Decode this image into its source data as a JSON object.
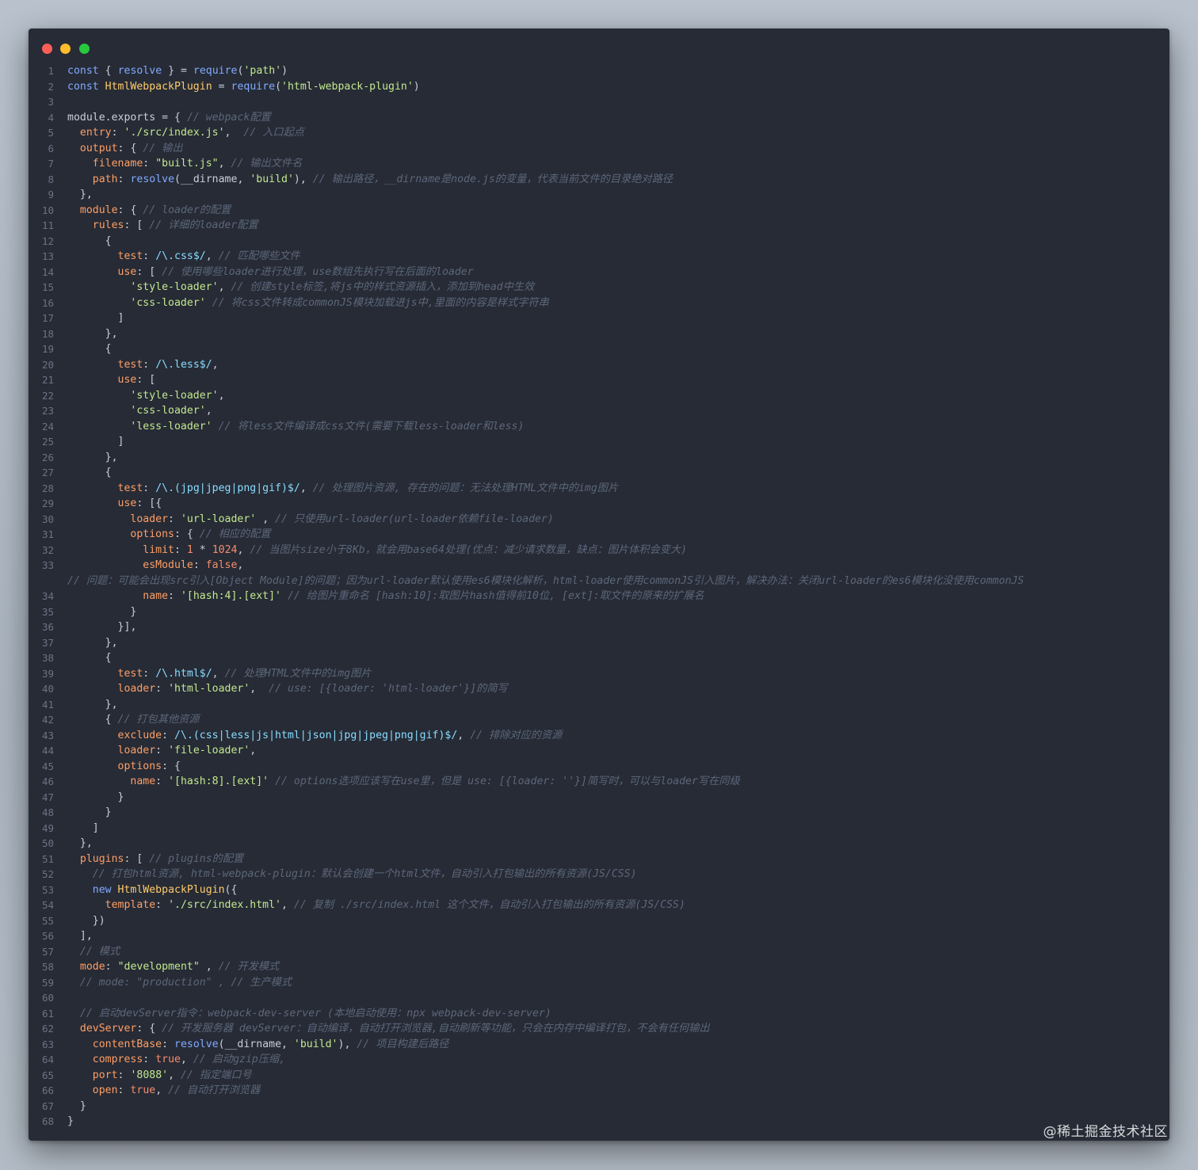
{
  "window": {
    "buttons": [
      {
        "name": "close",
        "color": "#fd5f57"
      },
      {
        "name": "minimize",
        "color": "#febc2e"
      },
      {
        "name": "maximize",
        "color": "#28c840"
      }
    ]
  },
  "code_lines": [
    {
      "n": "1",
      "t": "const { resolve } = require('path')"
    },
    {
      "n": "2",
      "t": "const HtmlWebpackPlugin = require('html-webpack-plugin')"
    },
    {
      "n": "3",
      "t": ""
    },
    {
      "n": "4",
      "t": "module.exports = { // webpack配置"
    },
    {
      "n": "5",
      "t": "  entry: './src/index.js',  // 入口起点"
    },
    {
      "n": "6",
      "t": "  output: { // 输出"
    },
    {
      "n": "7",
      "t": "    filename: \"built.js\", // 输出文件名"
    },
    {
      "n": "8",
      "t": "    path: resolve(__dirname, 'build'), // 输出路径，__dirname是node.js的变量，代表当前文件的目录绝对路径"
    },
    {
      "n": "9",
      "t": "  },"
    },
    {
      "n": "10",
      "t": "  module: { // loader的配置"
    },
    {
      "n": "11",
      "t": "    rules: [ // 详细的loader配置"
    },
    {
      "n": "12",
      "t": "      {"
    },
    {
      "n": "13",
      "t": "        test: /\\.css$/, // 匹配哪些文件"
    },
    {
      "n": "14",
      "t": "        use: [ // 使用哪些loader进行处理，use数组先执行写在后面的loader"
    },
    {
      "n": "15",
      "t": "          'style-loader', // 创建style标签,将js中的样式资源插入，添加到head中生效"
    },
    {
      "n": "16",
      "t": "          'css-loader' // 将css文件转成commonJS模块加载进js中,里面的内容是样式字符串"
    },
    {
      "n": "17",
      "t": "        ]"
    },
    {
      "n": "18",
      "t": "      },"
    },
    {
      "n": "19",
      "t": "      {"
    },
    {
      "n": "20",
      "t": "        test: /\\.less$/,"
    },
    {
      "n": "21",
      "t": "        use: ["
    },
    {
      "n": "22",
      "t": "          'style-loader',"
    },
    {
      "n": "23",
      "t": "          'css-loader',"
    },
    {
      "n": "24",
      "t": "          'less-loader' // 将less文件编译成css文件(需要下载less-loader和less)"
    },
    {
      "n": "25",
      "t": "        ]"
    },
    {
      "n": "26",
      "t": "      },"
    },
    {
      "n": "27",
      "t": "      {"
    },
    {
      "n": "28",
      "t": "        test: /\\.(jpg|jpeg|png|gif)$/, // 处理图片资源, 存在的问题：无法处理HTML文件中的img图片"
    },
    {
      "n": "29",
      "t": "        use: [{"
    },
    {
      "n": "30",
      "t": "          loader: 'url-loader' , // 只使用url-loader(url-loader依赖file-loader)"
    },
    {
      "n": "31",
      "t": "          options: { // 相应的配置"
    },
    {
      "n": "32",
      "t": "            limit: 1 * 1024, // 当图片size小于8Kb，就会用base64处理(优点：减少请求数量，缺点：图片体积会变大)"
    },
    {
      "n": "33",
      "t": "            esModule: false,"
    },
    {
      "n": "",
      "t": "// 问题：可能会出现src引入[Object Module]的问题；因为url-loader默认使用es6模块化解析，html-loader使用commonJS引入图片，解决办法：关闭url-loader的es6模块化没使用commonJS"
    },
    {
      "n": "34",
      "t": "            name: '[hash:4].[ext]' // 给图片重命名 [hash:10]:取图片hash值得前10位, [ext]:取文件的原来的扩展名"
    },
    {
      "n": "35",
      "t": "          }"
    },
    {
      "n": "36",
      "t": "        }],"
    },
    {
      "n": "37",
      "t": "      },"
    },
    {
      "n": "38",
      "t": "      {"
    },
    {
      "n": "39",
      "t": "        test: /\\.html$/, // 处理HTML文件中的img图片"
    },
    {
      "n": "40",
      "t": "        loader: 'html-loader',  // use: [{loader: 'html-loader'}]的简写"
    },
    {
      "n": "41",
      "t": "      },"
    },
    {
      "n": "42",
      "t": "      { // 打包其他资源"
    },
    {
      "n": "43",
      "t": "        exclude: /\\.(css|less|js|html|json|jpg|jpeg|png|gif)$/, // 排除对应的资源"
    },
    {
      "n": "44",
      "t": "        loader: 'file-loader',"
    },
    {
      "n": "45",
      "t": "        options: {"
    },
    {
      "n": "46",
      "t": "          name: '[hash:8].[ext]' // options选项应该写在use里，但是 use: [{loader: ''}]简写时，可以与loader写在同级"
    },
    {
      "n": "47",
      "t": "        }"
    },
    {
      "n": "48",
      "t": "      }"
    },
    {
      "n": "49",
      "t": "    ]"
    },
    {
      "n": "50",
      "t": "  },"
    },
    {
      "n": "51",
      "t": "  plugins: [ // plugins的配置"
    },
    {
      "n": "52",
      "t": "    // 打包html资源, html-webpack-plugin：默认会创建一个html文件，自动引入打包输出的所有资源(JS/CSS)"
    },
    {
      "n": "53",
      "t": "    new HtmlWebpackPlugin({"
    },
    {
      "n": "54",
      "t": "      template: './src/index.html', // 复制 ./src/index.html 这个文件，自动引入打包输出的所有资源(JS/CSS)"
    },
    {
      "n": "55",
      "t": "    })"
    },
    {
      "n": "56",
      "t": "  ],"
    },
    {
      "n": "57",
      "t": "  // 模式"
    },
    {
      "n": "58",
      "t": "  mode: \"development\" , // 开发模式"
    },
    {
      "n": "59",
      "t": "  // mode: \"production\" , // 生产模式"
    },
    {
      "n": "60",
      "t": ""
    },
    {
      "n": "61",
      "t": "  // 启动devServer指令：webpack-dev-server (本地启动使用：npx webpack-dev-server)"
    },
    {
      "n": "62",
      "t": "  devServer: { // 开发服务器 devServer：自动编译，自动打开浏览器,自动刷新等功能，只会在内存中编译打包，不会有任何输出"
    },
    {
      "n": "63",
      "t": "    contentBase: resolve(__dirname, 'build'), // 项目构建后路径"
    },
    {
      "n": "64",
      "t": "    compress: true, // 启动gzip压缩,"
    },
    {
      "n": "65",
      "t": "    port: '8088', // 指定端口号"
    },
    {
      "n": "66",
      "t": "    open: true, // 自动打开浏览器"
    },
    {
      "n": "67",
      "t": "  }"
    },
    {
      "n": "68",
      "t": "}"
    }
  ],
  "watermark": "@稀土掘金技术社区"
}
